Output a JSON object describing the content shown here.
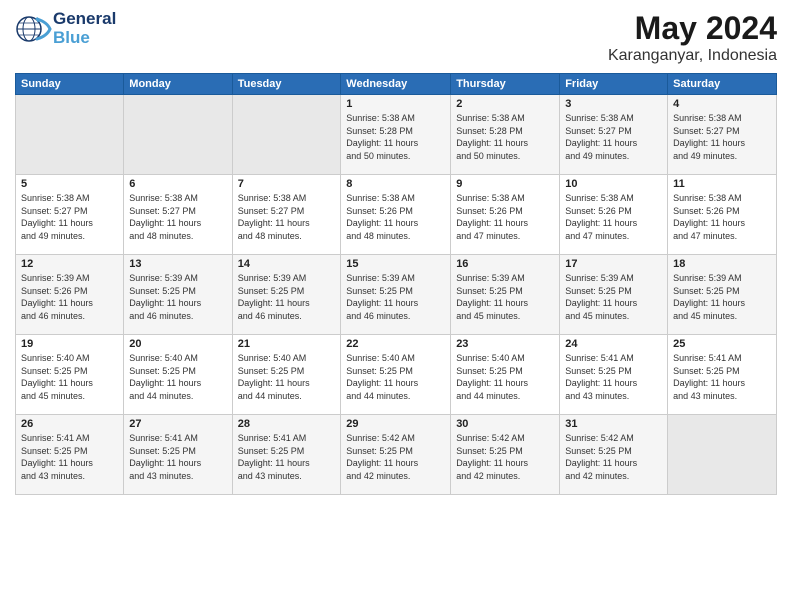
{
  "header": {
    "logo": {
      "general": "General",
      "blue": "Blue"
    },
    "title": "May 2024",
    "subtitle": "Karanganyar, Indonesia"
  },
  "weekdays": [
    "Sunday",
    "Monday",
    "Tuesday",
    "Wednesday",
    "Thursday",
    "Friday",
    "Saturday"
  ],
  "weeks": [
    {
      "days": [
        {
          "num": "",
          "info": "",
          "empty": true
        },
        {
          "num": "",
          "info": "",
          "empty": true
        },
        {
          "num": "",
          "info": "",
          "empty": true
        },
        {
          "num": "1",
          "info": "Sunrise: 5:38 AM\nSunset: 5:28 PM\nDaylight: 11 hours\nand 50 minutes."
        },
        {
          "num": "2",
          "info": "Sunrise: 5:38 AM\nSunset: 5:28 PM\nDaylight: 11 hours\nand 50 minutes."
        },
        {
          "num": "3",
          "info": "Sunrise: 5:38 AM\nSunset: 5:27 PM\nDaylight: 11 hours\nand 49 minutes."
        },
        {
          "num": "4",
          "info": "Sunrise: 5:38 AM\nSunset: 5:27 PM\nDaylight: 11 hours\nand 49 minutes."
        }
      ]
    },
    {
      "days": [
        {
          "num": "5",
          "info": "Sunrise: 5:38 AM\nSunset: 5:27 PM\nDaylight: 11 hours\nand 49 minutes."
        },
        {
          "num": "6",
          "info": "Sunrise: 5:38 AM\nSunset: 5:27 PM\nDaylight: 11 hours\nand 48 minutes."
        },
        {
          "num": "7",
          "info": "Sunrise: 5:38 AM\nSunset: 5:27 PM\nDaylight: 11 hours\nand 48 minutes."
        },
        {
          "num": "8",
          "info": "Sunrise: 5:38 AM\nSunset: 5:26 PM\nDaylight: 11 hours\nand 48 minutes."
        },
        {
          "num": "9",
          "info": "Sunrise: 5:38 AM\nSunset: 5:26 PM\nDaylight: 11 hours\nand 47 minutes."
        },
        {
          "num": "10",
          "info": "Sunrise: 5:38 AM\nSunset: 5:26 PM\nDaylight: 11 hours\nand 47 minutes."
        },
        {
          "num": "11",
          "info": "Sunrise: 5:38 AM\nSunset: 5:26 PM\nDaylight: 11 hours\nand 47 minutes."
        }
      ]
    },
    {
      "days": [
        {
          "num": "12",
          "info": "Sunrise: 5:39 AM\nSunset: 5:26 PM\nDaylight: 11 hours\nand 46 minutes."
        },
        {
          "num": "13",
          "info": "Sunrise: 5:39 AM\nSunset: 5:25 PM\nDaylight: 11 hours\nand 46 minutes."
        },
        {
          "num": "14",
          "info": "Sunrise: 5:39 AM\nSunset: 5:25 PM\nDaylight: 11 hours\nand 46 minutes."
        },
        {
          "num": "15",
          "info": "Sunrise: 5:39 AM\nSunset: 5:25 PM\nDaylight: 11 hours\nand 46 minutes."
        },
        {
          "num": "16",
          "info": "Sunrise: 5:39 AM\nSunset: 5:25 PM\nDaylight: 11 hours\nand 45 minutes."
        },
        {
          "num": "17",
          "info": "Sunrise: 5:39 AM\nSunset: 5:25 PM\nDaylight: 11 hours\nand 45 minutes."
        },
        {
          "num": "18",
          "info": "Sunrise: 5:39 AM\nSunset: 5:25 PM\nDaylight: 11 hours\nand 45 minutes."
        }
      ]
    },
    {
      "days": [
        {
          "num": "19",
          "info": "Sunrise: 5:40 AM\nSunset: 5:25 PM\nDaylight: 11 hours\nand 45 minutes."
        },
        {
          "num": "20",
          "info": "Sunrise: 5:40 AM\nSunset: 5:25 PM\nDaylight: 11 hours\nand 44 minutes."
        },
        {
          "num": "21",
          "info": "Sunrise: 5:40 AM\nSunset: 5:25 PM\nDaylight: 11 hours\nand 44 minutes."
        },
        {
          "num": "22",
          "info": "Sunrise: 5:40 AM\nSunset: 5:25 PM\nDaylight: 11 hours\nand 44 minutes."
        },
        {
          "num": "23",
          "info": "Sunrise: 5:40 AM\nSunset: 5:25 PM\nDaylight: 11 hours\nand 44 minutes."
        },
        {
          "num": "24",
          "info": "Sunrise: 5:41 AM\nSunset: 5:25 PM\nDaylight: 11 hours\nand 43 minutes."
        },
        {
          "num": "25",
          "info": "Sunrise: 5:41 AM\nSunset: 5:25 PM\nDaylight: 11 hours\nand 43 minutes."
        }
      ]
    },
    {
      "days": [
        {
          "num": "26",
          "info": "Sunrise: 5:41 AM\nSunset: 5:25 PM\nDaylight: 11 hours\nand 43 minutes."
        },
        {
          "num": "27",
          "info": "Sunrise: 5:41 AM\nSunset: 5:25 PM\nDaylight: 11 hours\nand 43 minutes."
        },
        {
          "num": "28",
          "info": "Sunrise: 5:41 AM\nSunset: 5:25 PM\nDaylight: 11 hours\nand 43 minutes."
        },
        {
          "num": "29",
          "info": "Sunrise: 5:42 AM\nSunset: 5:25 PM\nDaylight: 11 hours\nand 42 minutes."
        },
        {
          "num": "30",
          "info": "Sunrise: 5:42 AM\nSunset: 5:25 PM\nDaylight: 11 hours\nand 42 minutes."
        },
        {
          "num": "31",
          "info": "Sunrise: 5:42 AM\nSunset: 5:25 PM\nDaylight: 11 hours\nand 42 minutes."
        },
        {
          "num": "",
          "info": "",
          "empty": true
        }
      ]
    }
  ]
}
